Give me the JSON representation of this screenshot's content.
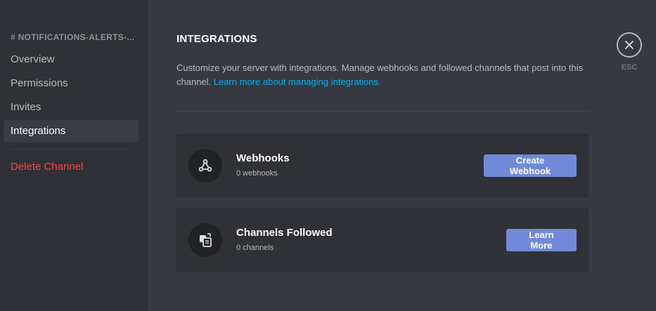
{
  "sidebar": {
    "header": "# NOTIFICATIONS-ALERTS-...",
    "items": [
      {
        "label": "Overview"
      },
      {
        "label": "Permissions"
      },
      {
        "label": "Invites"
      },
      {
        "label": "Integrations",
        "active": true
      }
    ],
    "delete_label": "Delete Channel"
  },
  "main": {
    "title": "INTEGRATIONS",
    "description": "Customize your server with integrations. Manage webhooks and followed channels that post into this channel.",
    "learn_link": "Learn more about managing integrations."
  },
  "cards": {
    "webhooks": {
      "icon": "webhook-icon",
      "title": "Webhooks",
      "subtitle": "0 webhooks",
      "button": "Create Webhook"
    },
    "channels_followed": {
      "icon": "channel-follow-icon",
      "title": "Channels Followed",
      "subtitle": "0 channels",
      "button": "Learn More"
    }
  },
  "close": {
    "icon": "close-icon",
    "label": "ESC"
  },
  "colors": {
    "background": "#36393f",
    "sidebar": "#2f3136",
    "accent": "#7289da",
    "link": "#00b0f4",
    "danger": "#f04747"
  }
}
